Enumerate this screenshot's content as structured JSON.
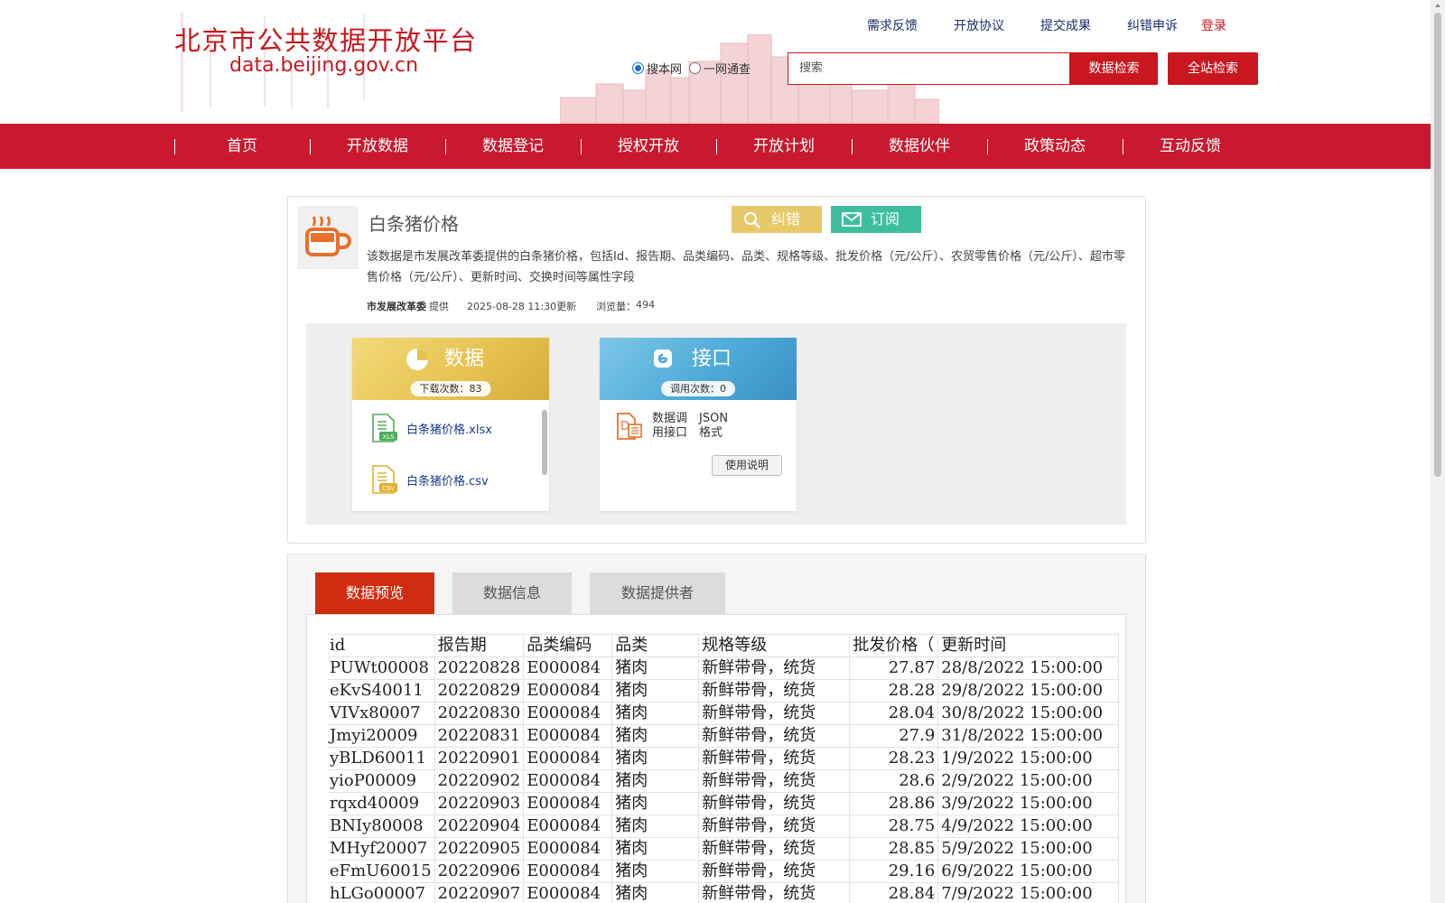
{
  "site": {
    "title_cn": "北京市公共数据开放平台",
    "title_en": "data.beijing.gov.cn",
    "brand_color": "#c8171e"
  },
  "toplinks": [
    {
      "label": "需求反馈"
    },
    {
      "label": "开放协议"
    },
    {
      "label": "提交成果"
    },
    {
      "label": "纠错申诉"
    }
  ],
  "login_label": "登录",
  "search": {
    "scope_site": "搜本网",
    "scope_all": "一网通查",
    "placeholder": "搜索",
    "data_search_label": "数据检索",
    "site_search_label": "全站检索"
  },
  "nav": [
    "首页",
    "开放数据",
    "数据登记",
    "授权开放",
    "开放计划",
    "数据伙伴",
    "政策动态",
    "互动反馈"
  ],
  "dataset": {
    "title": "白条猪价格",
    "report_error_label": "纠错",
    "subscribe_label": "订阅",
    "description": "该数据是市发展改革委提供的白条猪价格，包括Id、报告期、品类编码、品类、规格等级、批发价格（元/公斤）、农贸零售价格（元/公斤）、超市零售价格（元/公斤）、更新时间、交换时间等属性字段",
    "provider": "市发展改革委",
    "provider_suffix": "提供",
    "updated": "2025-08-28 11:30更新",
    "views_label": "浏览量：",
    "views": "494"
  },
  "data_panel": {
    "title": "数据",
    "count_label": "下载次数：83",
    "files": [
      {
        "name": "白条猪价格.xlsx",
        "ext": "XLS"
      },
      {
        "name": "白条猪价格.csv",
        "ext": "CSV"
      }
    ]
  },
  "api_panel": {
    "title": "接口",
    "count_label": "调用次数：0",
    "type_line1": "数据调",
    "type_line2": "用接口",
    "format_line1": "JSON",
    "format_line2": "格式",
    "usage_label": "使用说明"
  },
  "tabs": [
    "数据预览",
    "数据信息",
    "数据提供者"
  ],
  "preview": {
    "headers": [
      "id",
      "报告期",
      "品类编码",
      "品类",
      "规格等级",
      "批发价格（",
      "更新时间"
    ],
    "rows": [
      [
        "PUWt00008",
        "20220828",
        "E000084",
        "猪肉",
        "新鲜带骨，统货",
        "27.87",
        "28/8/2022  15:00:00"
      ],
      [
        "eKvS40011",
        "20220829",
        "E000084",
        "猪肉",
        "新鲜带骨，统货",
        "28.28",
        "29/8/2022  15:00:00"
      ],
      [
        "VIVx80007",
        "20220830",
        "E000084",
        "猪肉",
        "新鲜带骨，统货",
        "28.04",
        "30/8/2022  15:00:00"
      ],
      [
        "Jmyi20009",
        "20220831",
        "E000084",
        "猪肉",
        "新鲜带骨，统货",
        "27.9",
        "31/8/2022  15:00:00"
      ],
      [
        "yBLD60011",
        "20220901",
        "E000084",
        "猪肉",
        "新鲜带骨，统货",
        "28.23",
        "1/9/2022  15:00:00"
      ],
      [
        "yioP00009",
        "20220902",
        "E000084",
        "猪肉",
        "新鲜带骨，统货",
        "28.6",
        "2/9/2022  15:00:00"
      ],
      [
        "rqxd40009",
        "20220903",
        "E000084",
        "猪肉",
        "新鲜带骨，统货",
        "28.86",
        "3/9/2022  15:00:00"
      ],
      [
        "BNIy80008",
        "20220904",
        "E000084",
        "猪肉",
        "新鲜带骨，统货",
        "28.75",
        "4/9/2022  15:00:00"
      ],
      [
        "MHyf20007",
        "20220905",
        "E000084",
        "猪肉",
        "新鲜带骨，统货",
        "28.85",
        "5/9/2022  15:00:00"
      ],
      [
        "eFmU60015",
        "20220906",
        "E000084",
        "猪肉",
        "新鲜带骨，统货",
        "29.16",
        "6/9/2022  15:00:00"
      ],
      [
        "hLGo00007",
        "20220907",
        "E000084",
        "猪肉",
        "新鲜带骨，统货",
        "28.84",
        "7/9/2022  15:00:00"
      ]
    ]
  }
}
